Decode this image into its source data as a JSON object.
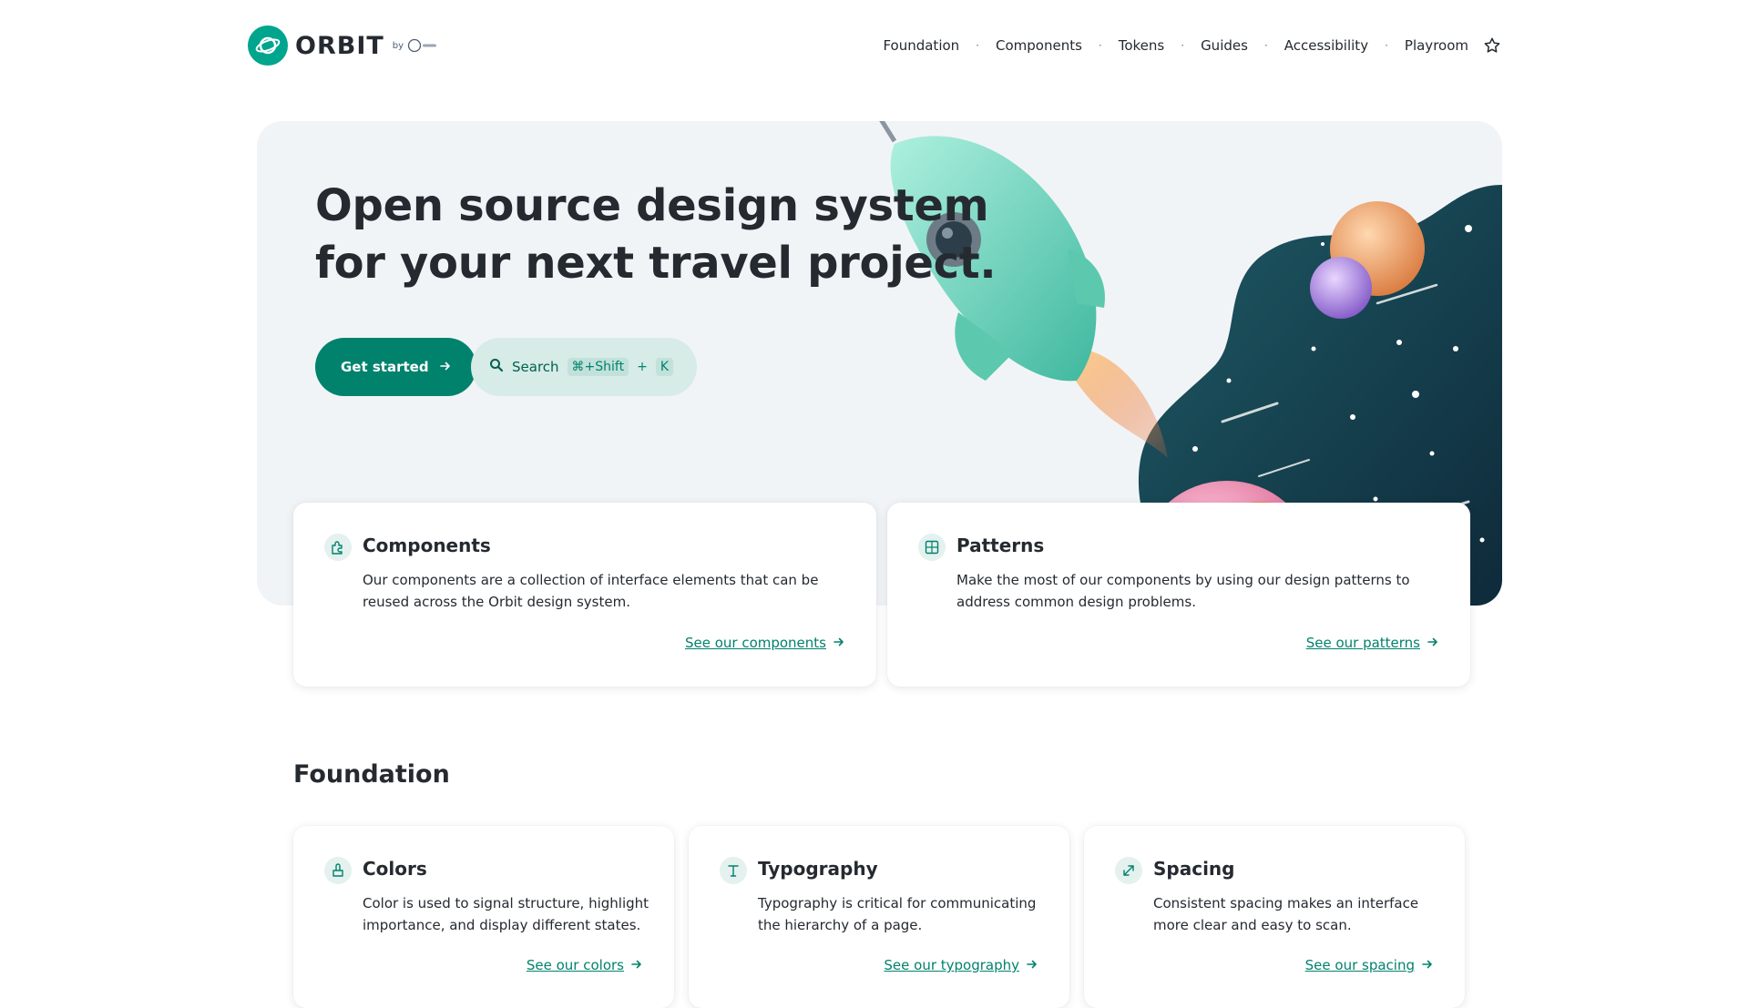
{
  "header": {
    "brand": "ORBIT",
    "by": "by",
    "nav": [
      "Foundation",
      "Components",
      "Tokens",
      "Guides",
      "Accessibility",
      "Playroom"
    ],
    "icons": {
      "logo": "planet-logo-icon",
      "star": "star-icon"
    }
  },
  "hero": {
    "title_line1": "Open source design system",
    "title_line2": "for your next travel project.",
    "primary_button": "Get started",
    "search": {
      "label": "Search",
      "shortcut_1": "⌘+Shift",
      "shortcut_plus": "+",
      "shortcut_2": "K"
    }
  },
  "cards": [
    {
      "title": "Components",
      "desc": "Our components are a collection of interface elements that can be reused across the Orbit design system.",
      "link": "See our components",
      "icon": "puzzle-icon"
    },
    {
      "title": "Patterns",
      "desc": "Make the most of our components by using our design patterns to address common design problems.",
      "link": "See our patterns",
      "icon": "pattern-icon"
    }
  ],
  "foundation": {
    "title": "Foundation",
    "cards": [
      {
        "title": "Colors",
        "desc": "Color is used to signal structure, highlight importance, and display different states.",
        "link": "See our colors",
        "icon": "paint-bucket-icon"
      },
      {
        "title": "Typography",
        "desc": "Typography is critical for communicating the hierarchy of a page.",
        "link": "See our typography",
        "icon": "text-t-icon"
      },
      {
        "title": "Spacing",
        "desc": "Consistent spacing makes an interface more clear and easy to scan.",
        "link": "See our spacing",
        "icon": "resize-diagonal-icon"
      }
    ]
  },
  "colors": {
    "primary": "#00826d",
    "brand": "#00a58e",
    "text": "#252a31",
    "hero_bg": "#f1f4f7"
  }
}
